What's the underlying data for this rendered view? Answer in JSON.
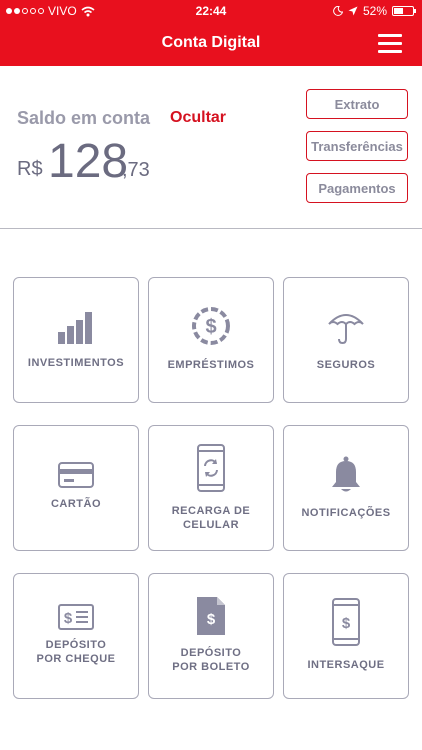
{
  "status_bar": {
    "carrier": "VIVO",
    "time": "22:44",
    "battery": "52%",
    "battery_level": 0.52
  },
  "header": {
    "title": "Conta Digital",
    "menu_icon": "hamburger-menu-icon",
    "background_color": "#e8101e"
  },
  "balance": {
    "label": "Saldo em conta",
    "hide_label": "Ocultar",
    "currency": "R$",
    "amount": "128",
    "cents": ",73"
  },
  "actions": [
    {
      "label": "Extrato"
    },
    {
      "label": "Transferências"
    },
    {
      "label": "Pagamentos"
    }
  ],
  "tiles": [
    {
      "label": "INVESTIMENTOS",
      "icon": "bar-chart-icon"
    },
    {
      "label": "EMPRÉSTIMOS",
      "icon": "dollar-coin-icon"
    },
    {
      "label": "SEGUROS",
      "icon": "umbrella-icon"
    },
    {
      "label": "CARTÃO",
      "icon": "credit-card-icon"
    },
    {
      "label": "RECARGA DE\nCELULAR",
      "icon": "phone-refresh-icon"
    },
    {
      "label": "NOTIFICAÇÕES",
      "icon": "bell-icon"
    },
    {
      "label": "DEPÓSITO\nPOR CHEQUE",
      "icon": "check-icon"
    },
    {
      "label": "DEPÓSITO\nPOR BOLETO",
      "icon": "document-dollar-icon"
    },
    {
      "label": "INTERSAQUE",
      "icon": "phone-dollar-icon"
    }
  ],
  "colors": {
    "accent": "#d51220",
    "icon_gray": "#8a8aa0",
    "border_gray": "#a9a9b8"
  }
}
